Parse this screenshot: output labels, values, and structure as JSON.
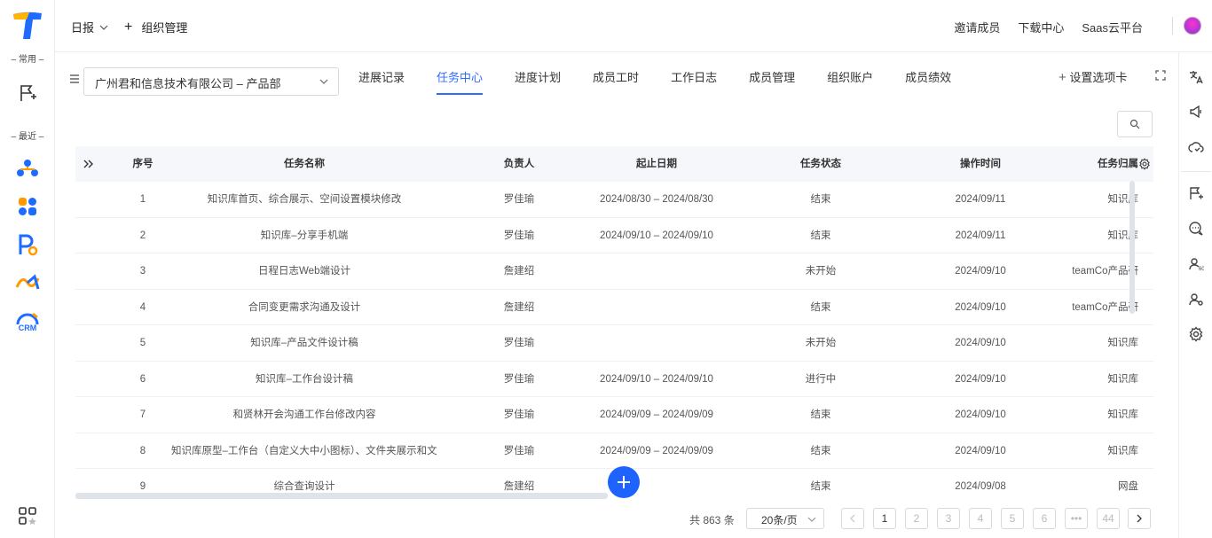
{
  "left_sidebar": {
    "common_label": "– 常用 –",
    "recent_label": "– 最近 –",
    "crm_label": "CRM"
  },
  "topbar": {
    "daily_report": "日报",
    "add_symbol": "+",
    "org_manage": "组织管理",
    "invite": "邀请成员",
    "download": "下载中心",
    "saas": "Saas云平台"
  },
  "toolbar": {
    "department": "广州君和信息技术有限公司 – 产品部",
    "tabs": [
      "进展记录",
      "任务中心",
      "进度计划",
      "成员工时",
      "工作日志",
      "成员管理",
      "组织账户",
      "成员绩效"
    ],
    "active_tab": "任务中心",
    "set_tabs": "设置选项卡"
  },
  "table": {
    "headers": [
      "序号",
      "任务名称",
      "负责人",
      "起止日期",
      "任务状态",
      "操作时间",
      "任务归属"
    ],
    "rows": [
      {
        "no": "1",
        "name": "知识库首页、综合展示、空间设置模块修改",
        "owner": "罗佳瑜",
        "dates": "2024/08/30 – 2024/08/30",
        "status": "结束",
        "optime": "2024/09/11",
        "belong": "知识库"
      },
      {
        "no": "2",
        "name": "知识库–分享手机端",
        "owner": "罗佳瑜",
        "dates": "2024/09/10 – 2024/09/10",
        "status": "结束",
        "optime": "2024/09/11",
        "belong": "知识库"
      },
      {
        "no": "3",
        "name": "日程日志Web端设计",
        "owner": "詹建绍",
        "dates": "",
        "status": "未开始",
        "optime": "2024/09/10",
        "belong": "teamCo产品研"
      },
      {
        "no": "4",
        "name": "合同变更需求沟通及设计",
        "owner": "詹建绍",
        "dates": "",
        "status": "结束",
        "optime": "2024/09/10",
        "belong": "teamCo产品研"
      },
      {
        "no": "5",
        "name": "知识库–产品文件设计稿",
        "owner": "罗佳瑜",
        "dates": "",
        "status": "未开始",
        "optime": "2024/09/10",
        "belong": "知识库"
      },
      {
        "no": "6",
        "name": "知识库–工作台设计稿",
        "owner": "罗佳瑜",
        "dates": "2024/09/10 – 2024/09/10",
        "status": "进行中",
        "optime": "2024/09/10",
        "belong": "知识库"
      },
      {
        "no": "7",
        "name": "和贤林开会沟通工作台修改内容",
        "owner": "罗佳瑜",
        "dates": "2024/09/09 – 2024/09/09",
        "status": "结束",
        "optime": "2024/09/10",
        "belong": "知识库"
      },
      {
        "no": "8",
        "name": "知识库原型–工作台（自定义大中小图标）、文件夹展示和文件…",
        "owner": "罗佳瑜",
        "dates": "2024/09/09 – 2024/09/09",
        "status": "结束",
        "optime": "2024/09/10",
        "belong": "知识库"
      },
      {
        "no": "9",
        "name": "综合查询设计",
        "owner": "詹建绍",
        "dates": "",
        "status": "结束",
        "optime": "2024/09/08",
        "belong": "网盘"
      }
    ]
  },
  "pagination": {
    "total": "共 863 条",
    "page_size": "20条/页",
    "pages": [
      "1",
      "2",
      "3",
      "4",
      "5",
      "6",
      "•••",
      "44"
    ],
    "current_page": "1"
  },
  "colors": {
    "accent": "#2f6bff",
    "fab": "#1f63ff"
  }
}
